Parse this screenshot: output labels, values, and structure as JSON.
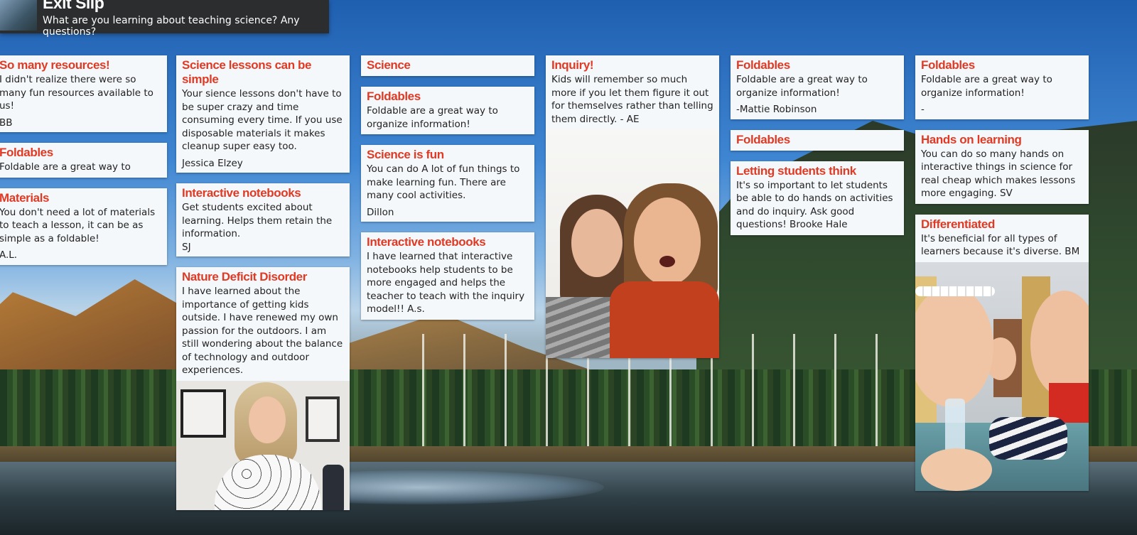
{
  "header": {
    "title": "Exit Slip",
    "subtitle": "What are you learning about teaching science? Any questions?"
  },
  "columns": [
    {
      "posts": [
        {
          "title": "So many resources!",
          "body": "I didn't realize there were so many fun resources available to us!",
          "author": "BB"
        },
        {
          "title": "Foldables",
          "body": "Foldable are a great way to"
        },
        {
          "title": "Materials",
          "body": "You don't need a lot of materials to teach a lesson, it can be as simple as a foldable!",
          "author": "A.L."
        }
      ]
    },
    {
      "posts": [
        {
          "title": "Science lessons can be simple",
          "body": "Your sience lessons don't have to be super crazy and time consuming every time. If you use disposable materials it makes cleanup super easy too.",
          "author": "Jessica Elzey"
        },
        {
          "title": "Interactive notebooks",
          "body": "Get students excited about learning. Helps them retain the information.",
          "author": "SJ"
        },
        {
          "title": "Nature Deficit Disorder",
          "body": "I have learned about the importance of getting kids outside. I have renewed my own passion for the outdoors.   I am still wondering about the balance of technology and outdoor experiences.",
          "photo": "office-portrait"
        }
      ]
    },
    {
      "posts": [
        {
          "title": "Science"
        },
        {
          "title": "Foldables",
          "body": "Foldable are a great way to organize information!"
        },
        {
          "title": "Science is fun",
          "body": "You can do A lot of fun things to make learning fun. There are many cool activities.",
          "author": "Dillon"
        },
        {
          "title": "Interactive notebooks",
          "body": "I have learned that interactive notebooks help students to be more engaged and helps the teacher to teach with the inquiry model!! A.s."
        }
      ]
    },
    {
      "posts": [
        {
          "title": "Inquiry!",
          "body": "Kids will remember so much more if you let them figure it out for themselves rather than telling them directly. - AE",
          "photo": "two-women-selfie"
        }
      ]
    },
    {
      "posts": [
        {
          "title": "Foldables",
          "body": "Foldable are a great way to organize information!",
          "author": "-Mattie Robinson"
        },
        {
          "title": "Foldables"
        },
        {
          "title": "Letting students think",
          "body": "It's so important to let students be able to do hands on activities and do inquiry. Ask good questions! Brooke Hale"
        }
      ]
    },
    {
      "posts": [
        {
          "title": "Foldables",
          "body": "Foldable are a great way to organize information!",
          "author": "-"
        },
        {
          "title": "Hands on learning",
          "body": "You can do so many hands on interactive things in science for real cheap which makes lessons more engaging. SV"
        },
        {
          "title": "Differentiated",
          "body": "It's beneficial for all types of learners because it's diverse. BM",
          "photo": "group-selfie"
        }
      ]
    }
  ]
}
